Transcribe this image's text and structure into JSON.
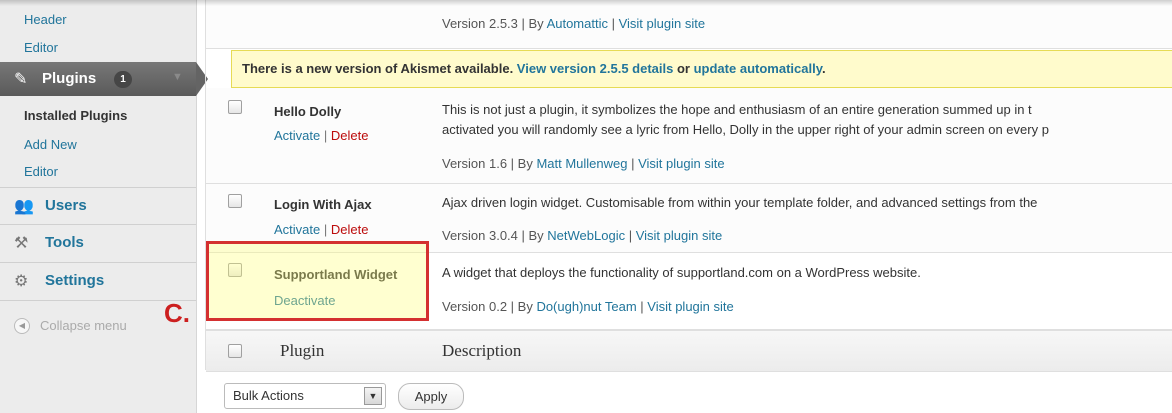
{
  "sidebar": {
    "header_link": "Header",
    "editor_link_top": "Editor",
    "plugins_label": "Plugins",
    "plugins_badge": "1",
    "installed_plugins": "Installed Plugins",
    "add_new": "Add New",
    "editor_link": "Editor",
    "users_label": "Users",
    "tools_label": "Tools",
    "settings_label": "Settings",
    "collapse_label": "Collapse menu",
    "icons": {
      "plugins": "plug-icon",
      "users": "users-icon",
      "tools": "tools-icon",
      "settings": "settings-icon",
      "collapse": "collapse-arrow-icon"
    }
  },
  "plugins": {
    "akismet": {
      "version_text": "Version 2.5.3 | By ",
      "author": "Automattic",
      "sep": " | ",
      "site_link": "Visit plugin site"
    },
    "update_notice": {
      "text": "There is a new version of Akismet available. ",
      "details_link": "View version 2.5.5 details",
      "or": " or ",
      "update_link": "update automatically",
      "end": "."
    },
    "hello_dolly": {
      "name": "Hello Dolly",
      "activate": "Activate",
      "sep": " | ",
      "delete": "Delete",
      "desc_line1": "This is not just a plugin, it symbolizes the hope and enthusiasm of an entire generation summed up in t",
      "desc_line2": "activated you will randomly see a lyric from Hello, Dolly in the upper right of your admin screen on every p",
      "version_text": "Version 1.6 | By ",
      "author": "Matt Mullenweg",
      "site_sep": " | ",
      "site_link": "Visit plugin site"
    },
    "login_with_ajax": {
      "name": "Login With Ajax",
      "activate": "Activate",
      "sep": " | ",
      "delete": "Delete",
      "desc": "Ajax driven login widget. Customisable from within your template folder, and advanced settings from the",
      "version_text": "Version 3.0.4 | By ",
      "author": "NetWebLogic",
      "site_sep": " | ",
      "site_link": "Visit plugin site"
    },
    "supportland": {
      "name": "Supportland Widget",
      "deactivate": "Deactivate",
      "desc": "A widget that deploys the functionality of supportland.com on a WordPress website.",
      "version_text": "Version 0.2 | By ",
      "author": "Do(ugh)nut Team",
      "site_sep": " | ",
      "site_link": "Visit plugin site"
    }
  },
  "table_footer": {
    "plugin_header": "Plugin",
    "description_header": "Description"
  },
  "bulk": {
    "selected": "Bulk Actions",
    "apply": "Apply"
  },
  "annotation": {
    "letter": "C.",
    "highlight_color": "#d43030"
  },
  "colors": {
    "link": "#21759b",
    "delete": "#bc0b0b",
    "notice_bg": "#fffbcc",
    "sidebar_bg": "#ececec",
    "active_menu": "#646464"
  }
}
